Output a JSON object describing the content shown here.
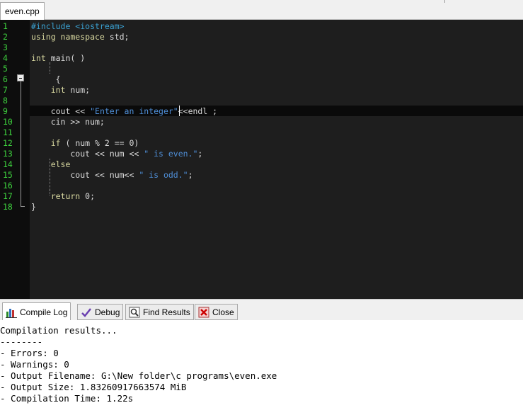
{
  "file_tab": {
    "label": "even.cpp"
  },
  "editor": {
    "line_numbers": [
      "1",
      "2",
      "3",
      "4",
      "5",
      "6",
      "7",
      "8",
      "9",
      "10",
      "11",
      "12",
      "13",
      "14",
      "15",
      "16",
      "17",
      "18"
    ],
    "lines": [
      [
        {
          "t": "#include <iostream>",
          "c": "pp"
        }
      ],
      [
        {
          "t": "using namespace ",
          "c": "kw"
        },
        {
          "t": "std;",
          "c": "id"
        }
      ],
      [],
      [
        {
          "t": "int ",
          "c": "kw"
        },
        {
          "t": "main( )",
          "c": "id"
        }
      ],
      [],
      [
        {
          "t": "     {",
          "c": "id"
        }
      ],
      [
        {
          "t": "    int ",
          "c": "kw"
        },
        {
          "t": "num;",
          "c": "id"
        }
      ],
      [],
      [
        {
          "t": "    cout << ",
          "c": "id"
        },
        {
          "t": "\"Enter an integer\"",
          "c": "str"
        },
        {
          "t": "<<endl ;",
          "c": "id"
        }
      ],
      [
        {
          "t": "    cin >> num;",
          "c": "id"
        }
      ],
      [],
      [
        {
          "t": "    if",
          "c": "kw"
        },
        {
          "t": " ( num % 2 == 0)",
          "c": "id"
        }
      ],
      [
        {
          "t": "        cout << num << ",
          "c": "id"
        },
        {
          "t": "\" is even.\"",
          "c": "str"
        },
        {
          "t": ";",
          "c": "id"
        }
      ],
      [
        {
          "t": "    else",
          "c": "kw"
        }
      ],
      [
        {
          "t": "        cout << num<< ",
          "c": "id"
        },
        {
          "t": "\" is odd.\"",
          "c": "str"
        },
        {
          "t": ";",
          "c": "id"
        }
      ],
      [],
      [
        {
          "t": "    return ",
          "c": "kw"
        },
        {
          "t": "0;",
          "c": "id"
        }
      ],
      [
        {
          "t": "}",
          "c": "id"
        }
      ]
    ]
  },
  "bottom_tabs": [
    {
      "label": "Compile Log",
      "icon": "chart-icon",
      "active": true
    },
    {
      "label": "Debug",
      "icon": "check-icon",
      "active": false
    },
    {
      "label": "Find Results",
      "icon": "find-icon",
      "active": false
    },
    {
      "label": "Close",
      "icon": "close-icon",
      "active": false
    }
  ],
  "compile_log": [
    "Compilation results...",
    "--------",
    "- Errors: 0",
    "- Warnings: 0",
    "- Output Filename: G:\\New folder\\c programs\\even.exe",
    "- Output Size: 1.83260917663574 MiB",
    "- Compilation Time: 1.22s"
  ],
  "colors": {
    "editor_bg": "#1e1e1e",
    "line_number": "#3ed13e",
    "keyword": "#d8d8a0",
    "string": "#4f8fd8"
  }
}
